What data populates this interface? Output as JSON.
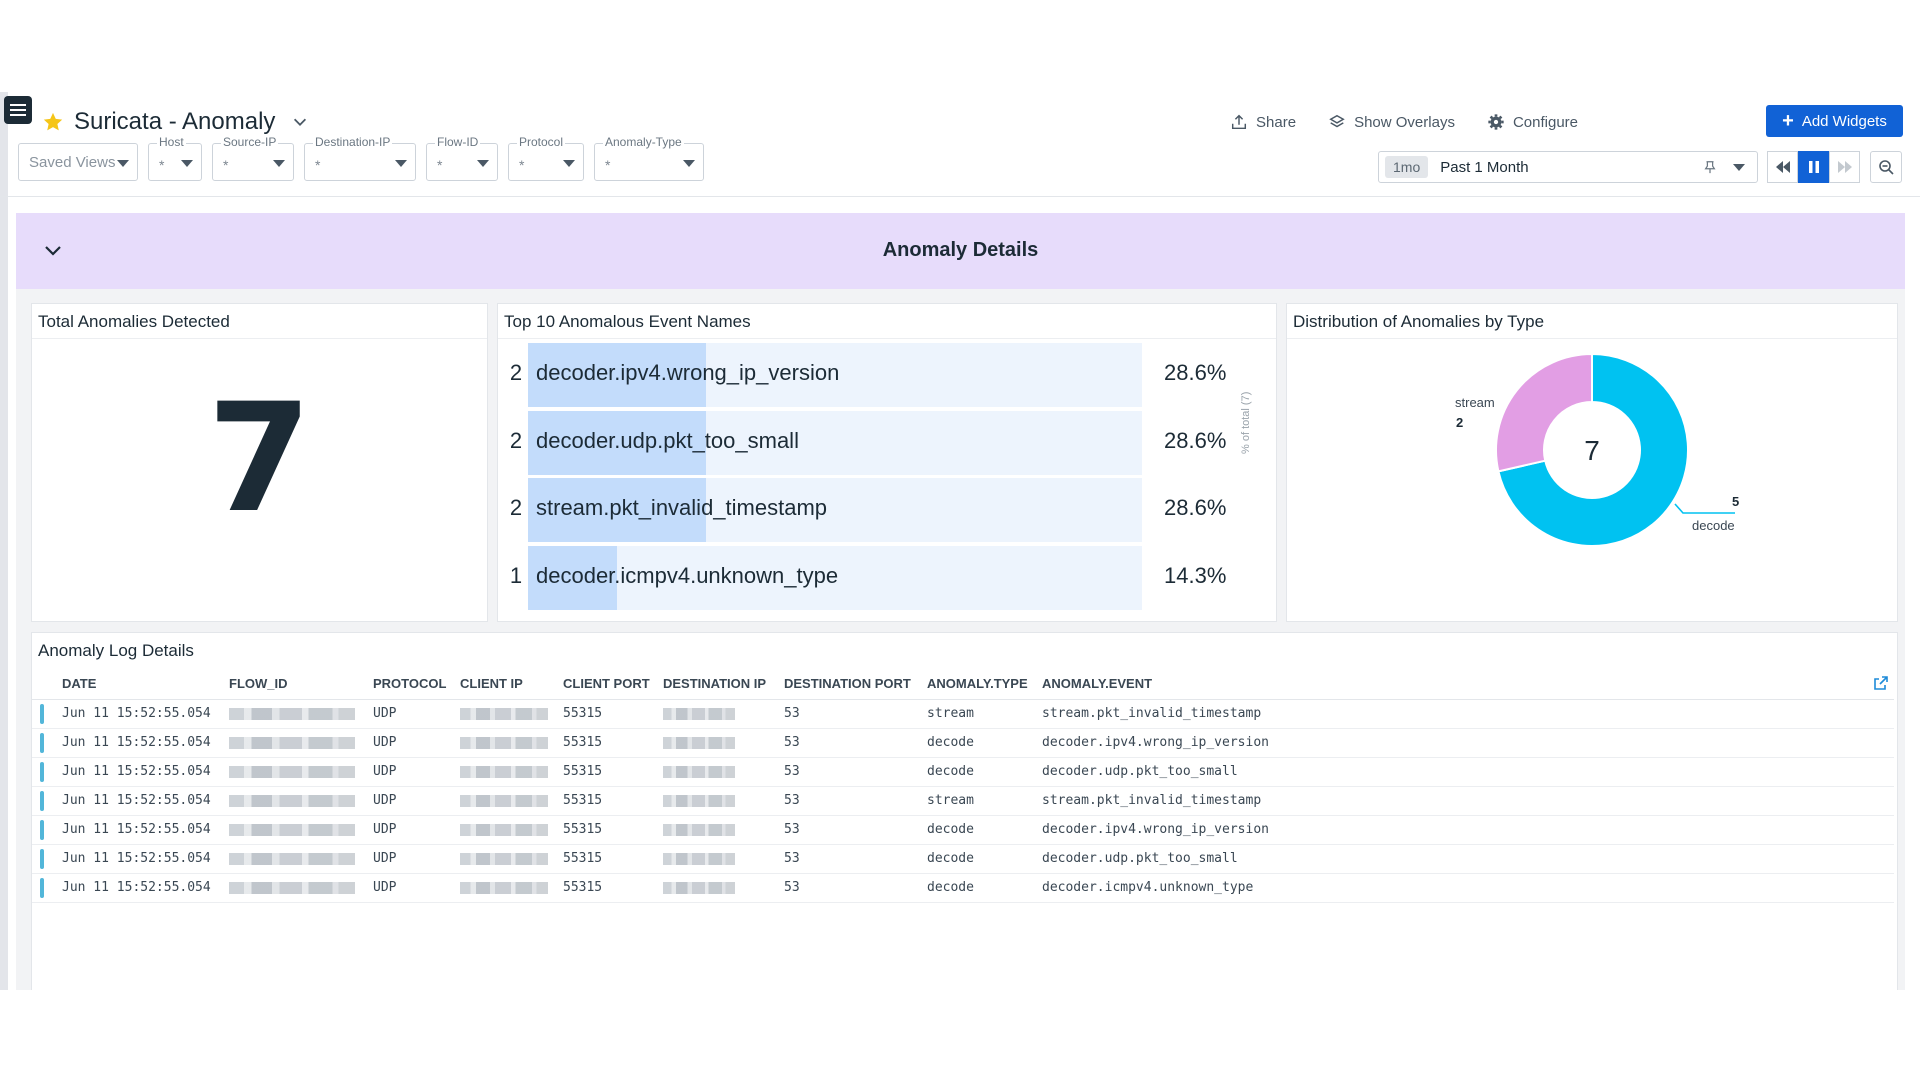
{
  "dashboard": {
    "title": "Suricata - Anomaly"
  },
  "header_actions": {
    "share": "Share",
    "show_overlays": "Show Overlays",
    "configure": "Configure",
    "add_widgets": "Add Widgets"
  },
  "filters": {
    "saved_views": "Saved Views",
    "items": [
      {
        "label": "Host",
        "value": "*"
      },
      {
        "label": "Source-IP",
        "value": "*"
      },
      {
        "label": "Destination-IP",
        "value": "*"
      },
      {
        "label": "Flow-ID",
        "value": "*"
      },
      {
        "label": "Protocol",
        "value": "*"
      },
      {
        "label": "Anomaly-Type",
        "value": "*"
      }
    ]
  },
  "timeframe": {
    "badge": "1mo",
    "text": "Past 1 Month"
  },
  "group": {
    "title": "Anomaly Details"
  },
  "widgets": {
    "total": {
      "title": "Total Anomalies Detected",
      "value": "7"
    },
    "top_list": {
      "title": "Top 10 Anomalous Event Names",
      "axis_label": "% of total (7)",
      "rows": [
        {
          "count": "2",
          "name": "decoder.ipv4.wrong_ip_version",
          "pct": "28.6%",
          "fraction": 0.286
        },
        {
          "count": "2",
          "name": "decoder.udp.pkt_too_small",
          "pct": "28.6%",
          "fraction": 0.286
        },
        {
          "count": "2",
          "name": "stream.pkt_invalid_timestamp",
          "pct": "28.6%",
          "fraction": 0.286
        },
        {
          "count": "1",
          "name": "decoder.icmpv4.unknown_type",
          "pct": "14.3%",
          "fraction": 0.143
        }
      ]
    },
    "distribution": {
      "title": "Distribution of Anomalies by Type",
      "center_value": "7",
      "slices": [
        {
          "label": "stream",
          "value": "2",
          "count": 2,
          "color": "#e29ee4"
        },
        {
          "label": "decode",
          "value": "5",
          "count": 5,
          "color": "#00c2f1"
        }
      ]
    },
    "logs": {
      "title": "Anomaly Log Details",
      "columns": [
        "DATE",
        "FLOW_ID",
        "PROTOCOL",
        "CLIENT IP",
        "CLIENT PORT",
        "DESTINATION IP",
        "DESTINATION PORT",
        "ANOMALY.TYPE",
        "ANOMALY.EVENT"
      ],
      "rows": [
        {
          "date": "Jun 11 15:52:55.054",
          "protocol": "UDP",
          "client_port": "55315",
          "dest_port": "53",
          "type": "stream",
          "event": "stream.pkt_invalid_timestamp"
        },
        {
          "date": "Jun 11 15:52:55.054",
          "protocol": "UDP",
          "client_port": "55315",
          "dest_port": "53",
          "type": "decode",
          "event": "decoder.ipv4.wrong_ip_version"
        },
        {
          "date": "Jun 11 15:52:55.054",
          "protocol": "UDP",
          "client_port": "55315",
          "dest_port": "53",
          "type": "decode",
          "event": "decoder.udp.pkt_too_small"
        },
        {
          "date": "Jun 11 15:52:55.054",
          "protocol": "UDP",
          "client_port": "55315",
          "dest_port": "53",
          "type": "stream",
          "event": "stream.pkt_invalid_timestamp"
        },
        {
          "date": "Jun 11 15:52:55.054",
          "protocol": "UDP",
          "client_port": "55315",
          "dest_port": "53",
          "type": "decode",
          "event": "decoder.ipv4.wrong_ip_version"
        },
        {
          "date": "Jun 11 15:52:55.054",
          "protocol": "UDP",
          "client_port": "55315",
          "dest_port": "53",
          "type": "decode",
          "event": "decoder.udp.pkt_too_small"
        },
        {
          "date": "Jun 11 15:52:55.054",
          "protocol": "UDP",
          "client_port": "55315",
          "dest_port": "53",
          "type": "decode",
          "event": "decoder.icmpv4.unknown_type"
        }
      ]
    }
  },
  "colors": {
    "accent": "#1162d6",
    "group_header": "#e7dcfb",
    "bar_fill": "#c3dcfb",
    "row_status": "#52b6d9"
  }
}
